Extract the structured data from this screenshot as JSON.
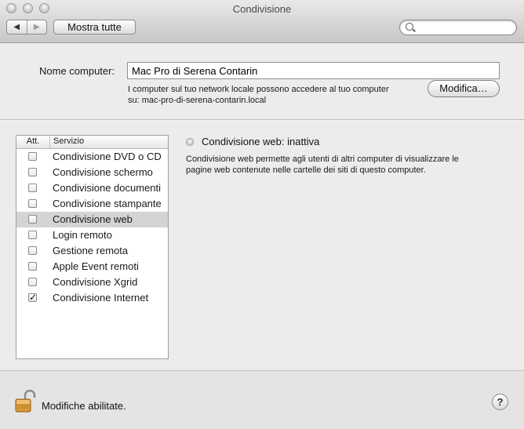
{
  "window": {
    "title": "Condivisione"
  },
  "toolbar": {
    "back_glyph": "◀",
    "forward_glyph": "▶",
    "show_all_label": "Mostra tutte",
    "search_placeholder": ""
  },
  "computer_name": {
    "label": "Nome computer:",
    "value": "Mac Pro di Serena Contarin",
    "description_line1": "I computer sul tuo network locale possono accedere al tuo computer",
    "description_line2": "su: mac-pro-di-serena-contarin.local",
    "edit_button": "Modifica…"
  },
  "services": {
    "header_on": "Att.",
    "header_service": "Servizio",
    "items": [
      {
        "label": "Condivisione DVD o CD",
        "checked": false,
        "selected": false
      },
      {
        "label": "Condivisione schermo",
        "checked": false,
        "selected": false
      },
      {
        "label": "Condivisione documenti",
        "checked": false,
        "selected": false
      },
      {
        "label": "Condivisione stampante",
        "checked": false,
        "selected": false
      },
      {
        "label": "Condivisione web",
        "checked": false,
        "selected": true
      },
      {
        "label": "Login remoto",
        "checked": false,
        "selected": false
      },
      {
        "label": "Gestione remota",
        "checked": false,
        "selected": false
      },
      {
        "label": "Apple Event remoti",
        "checked": false,
        "selected": false
      },
      {
        "label": "Condivisione Xgrid",
        "checked": false,
        "selected": false
      },
      {
        "label": "Condivisione Internet",
        "checked": true,
        "selected": false
      }
    ]
  },
  "detail": {
    "status": "Condivisione web: inattiva",
    "description_line1": "Condivisione web permette agli utenti di altri computer di visualizzare le",
    "description_line2": "pagine web contenute nelle cartelle dei siti di questo computer."
  },
  "footer": {
    "lock_text": "Modifiche abilitate.",
    "help_glyph": "?"
  },
  "colors": {
    "selected_row": "#d4d4d4",
    "window_bg": "#ececec",
    "lock_gold": "#d99a3a"
  }
}
